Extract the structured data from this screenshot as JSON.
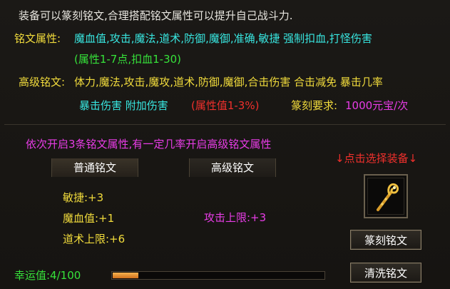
{
  "header": {
    "intro": "装备可以篆刻铭文,合理搭配铭文属性可以提升自己战斗力."
  },
  "rune_attrs": {
    "label": "铭文属性:",
    "list": "魔血值,攻击,魔法,道术,防御,魔御,准确,敏捷 强制扣血,打怪伤害",
    "range": "(属性1-7点,扣血1-30)"
  },
  "advanced_rune": {
    "label": "高级铭文:",
    "list_line1": "体力,魔法,攻击,魔攻,道术,防御,魔御,合击伤害 合击减免 暴击几率",
    "list_line2": "暴击伤害 附加伤害",
    "range": "(属性值1-3%)",
    "req_label": "篆刻要求:",
    "req_value": "1000元宝/次"
  },
  "info": {
    "notice": "依次开启3条铭文属性,有一定几率开启高级铭文属性",
    "equip_hint": "↓点击选择装备↓"
  },
  "tabs": {
    "normal": "普通铭文",
    "advanced": "高级铭文"
  },
  "normal_attrs": [
    "敏捷:+3",
    "魔血值:+1",
    "道术上限:+6"
  ],
  "advanced_attrs": [
    "攻击上限:+3"
  ],
  "equip_slot": {
    "item_icon": "golden-staff-icon"
  },
  "buttons": {
    "engrave": "篆刻铭文",
    "wash": "清洗铭文"
  },
  "luck": {
    "label": "幸运值:4/100",
    "value": 4,
    "max": 100
  },
  "colors": {
    "white": "#e8e6e0",
    "yellow": "#f2dc3c",
    "cyan": "#38e6e0",
    "green": "#36e23a",
    "red": "#f0302c",
    "magenta": "#e83ce6",
    "luck_fill": "#e8902c"
  }
}
